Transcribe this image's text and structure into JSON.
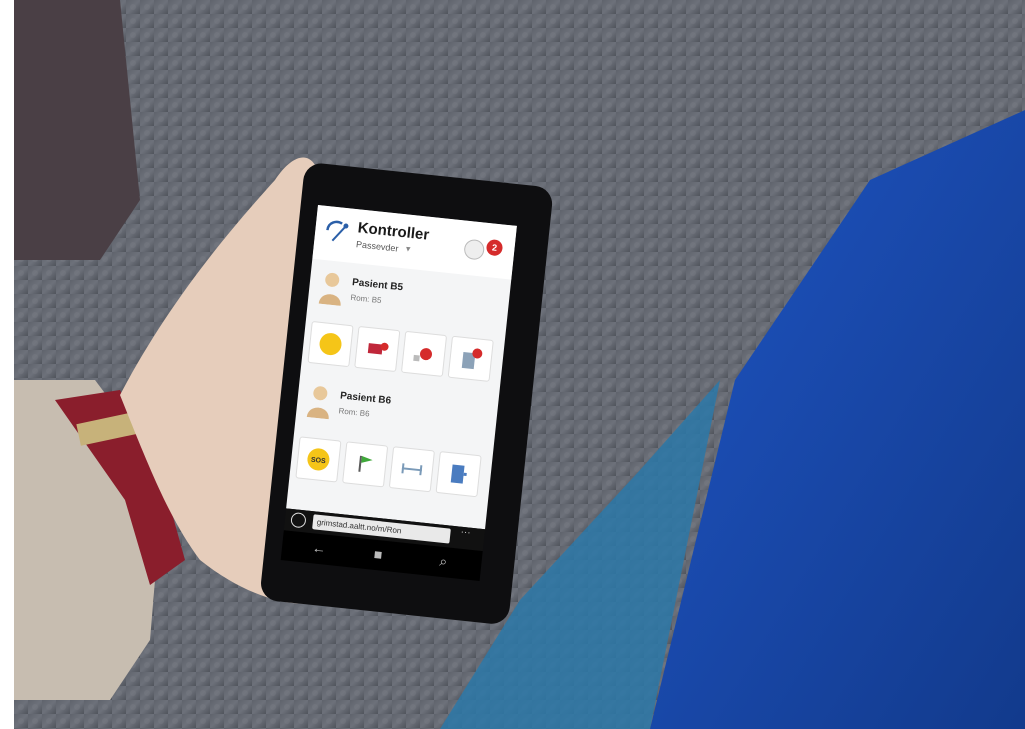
{
  "app": {
    "title": "Kontroller",
    "subtitle": "Passevder",
    "notification_count": "2"
  },
  "patients": [
    {
      "name": "Pasient B5",
      "room": "Rom: B5"
    },
    {
      "name": "Pasient B6",
      "room": "Rom: B6"
    }
  ],
  "browser": {
    "url": "grimstad.aaltt.no/m/Ron"
  },
  "icons": {
    "logo": "app-logo-icon",
    "back": "back-arrow-icon",
    "home": "windows-home-icon",
    "search": "search-icon",
    "sos": "sos-icon",
    "refresh": "refresh-icon"
  },
  "button_labels": {
    "sos": "SOS"
  }
}
